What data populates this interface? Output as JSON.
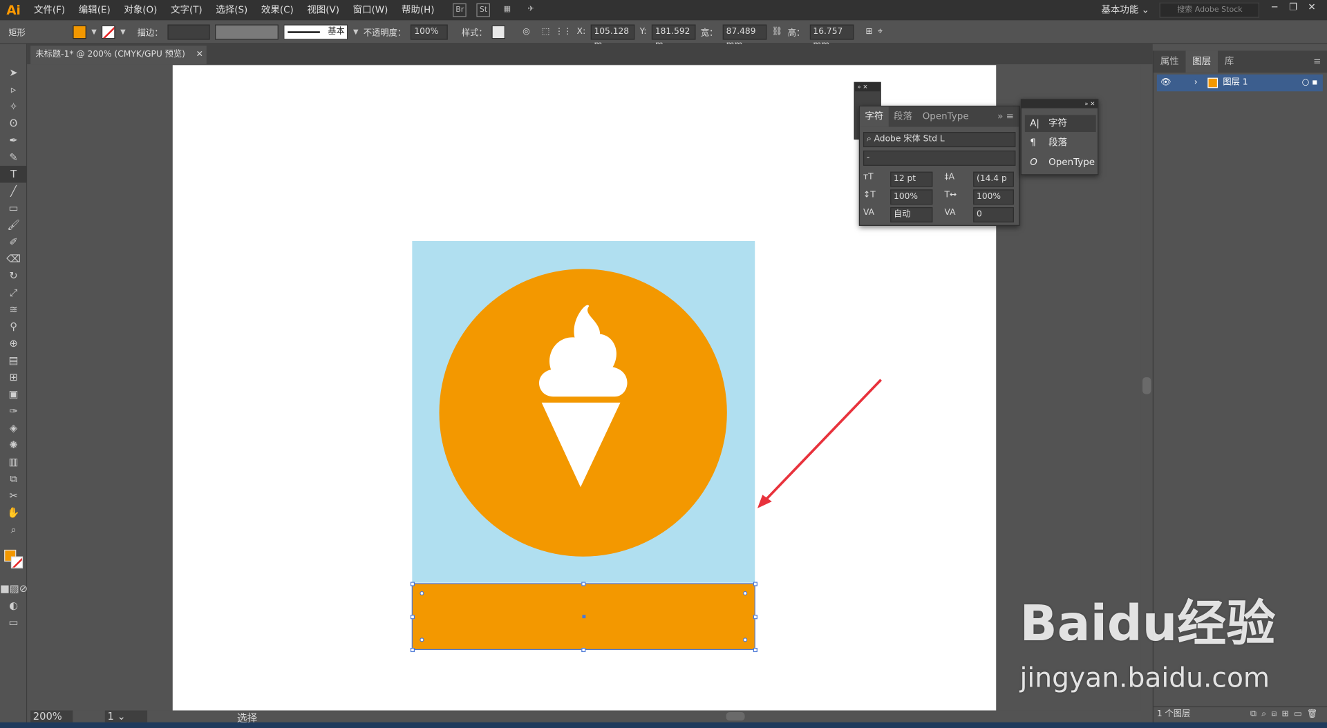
{
  "app": {
    "logo": "Ai"
  },
  "menu": [
    "文件(F)",
    "编辑(E)",
    "对象(O)",
    "文字(T)",
    "选择(S)",
    "效果(C)",
    "视图(V)",
    "窗口(W)",
    "帮助(H)"
  ],
  "menubar_icons": [
    "Br",
    "St"
  ],
  "workspace": "基本功能",
  "stock_search": "搜索 Adobe Stock",
  "control": {
    "object_type": "矩形",
    "fill_color": "#f39800",
    "stroke_label": "描边：",
    "stroke_style": "基本",
    "opacity_label": "不透明度：",
    "opacity": "100%",
    "style_label": "样式：",
    "x_label": "X:",
    "x": "105.128 m",
    "y_label": "Y:",
    "y": "181.592 m",
    "w_label": "宽：",
    "w": "87.489 mm",
    "h_label": "高：",
    "h": "16.757 mm"
  },
  "doc_tab": "未标题-1* @ 200% (CMYK/GPU 预览)",
  "artwork": {
    "background_color": "#b0dff0",
    "circle_color": "#f39800",
    "icon": "ice-cream-icon",
    "rect_color": "#f39800"
  },
  "char_panel": {
    "tabs": [
      "字符",
      "段落",
      "OpenType"
    ],
    "font": "Adobe 宋体 Std L",
    "style": "-",
    "size": "12 pt",
    "leading": "(14.4 p",
    "vscale": "100%",
    "hscale": "100%",
    "kerning": "自动",
    "tracking": "0"
  },
  "flyout": [
    "字符",
    "段落",
    "OpenType"
  ],
  "right_panel": {
    "tabs": [
      "属性",
      "图层",
      "库"
    ],
    "layer_name": "图层 1",
    "footer": "1 个图层"
  },
  "status": {
    "zoom": "200%",
    "page": "1",
    "tool": "选择"
  },
  "watermark": {
    "brand": "Baidu经验",
    "url": "jingyan.baidu.com"
  }
}
